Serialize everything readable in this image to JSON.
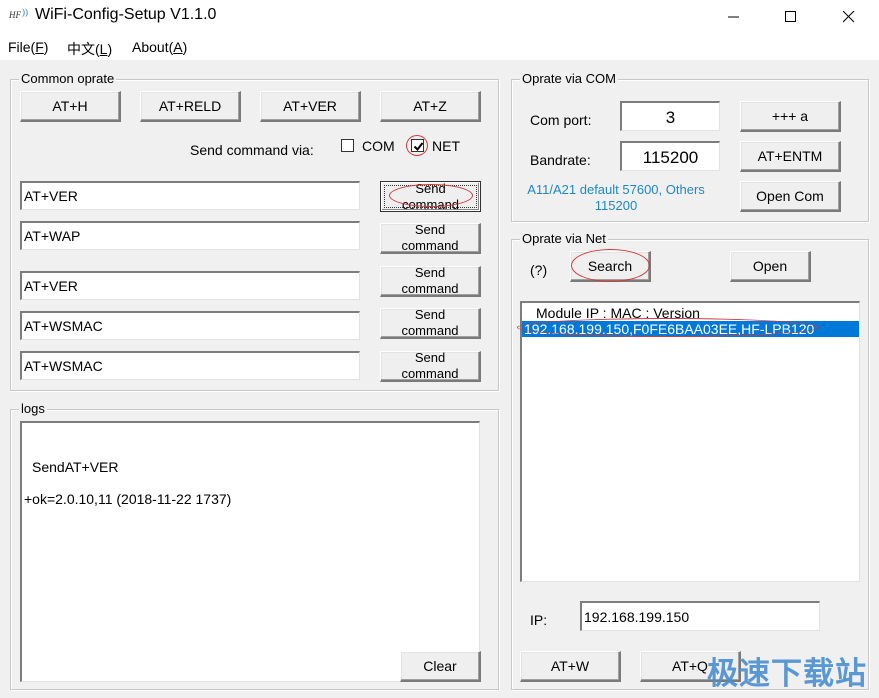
{
  "window": {
    "title": "WiFi-Config-Setup V1.1.0",
    "app_icon": "hf-wifi-logo-icon",
    "controls": [
      "minimize-icon",
      "maximize-icon",
      "close-icon"
    ]
  },
  "menu": {
    "items": [
      {
        "label": "File(",
        "mnemonic": "F",
        "suffix": ")"
      },
      {
        "label": "中文(",
        "mnemonic": "L",
        "suffix": ")"
      },
      {
        "label": "About(",
        "mnemonic": "A",
        "suffix": ")"
      }
    ]
  },
  "common": {
    "title": "Common oprate",
    "quick_buttons": [
      "AT+H",
      "AT+RELD",
      "AT+VER",
      "AT+Z"
    ],
    "send_via_label": "Send command via:",
    "com_label": "COM",
    "com_checked": false,
    "net_label": "NET",
    "net_checked": true,
    "send_label_line1": "Send",
    "send_label_line2": "command",
    "commands": [
      {
        "value": "AT+VER"
      },
      {
        "value": "AT+WAP"
      },
      {
        "value": "AT+VER"
      },
      {
        "value": "AT+WSMAC"
      },
      {
        "value": "AT+WSMAC"
      }
    ]
  },
  "logs": {
    "title": "logs",
    "lines": [
      "SendAT+VER",
      "+ok=2.0.10,11 (2018-11-22 1737)"
    ],
    "clear_label": "Clear"
  },
  "com": {
    "title": "Oprate via COM",
    "port_label": "Com port:",
    "port_value": "3",
    "baud_label": "Bandrate:",
    "baud_value": "115200",
    "hint_line1": "A11/A21 default 57600, Others",
    "hint_line2": "115200",
    "hint_color": "#1e88c7",
    "btn_plus": "+++ a",
    "btn_entm": "AT+ENTM",
    "btn_open": "Open Com"
  },
  "net": {
    "title": "Oprate via Net",
    "help": "(?)",
    "search_label": "Search",
    "open_label": "Open",
    "list_header": "Module IP  :  MAC  :  Version",
    "list_rows": [
      {
        "text": "192.168.199.150,F0FE6BAA03EE,HF-LPB120",
        "selected": true
      }
    ],
    "selection_color": "#0078d7",
    "ip_label": "IP:",
    "ip_value": "192.168.199.150",
    "btn_atw": "AT+W",
    "btn_atq": "AT+Q"
  },
  "watermark": "极速下载站",
  "annotation_color": "#d23a3a"
}
